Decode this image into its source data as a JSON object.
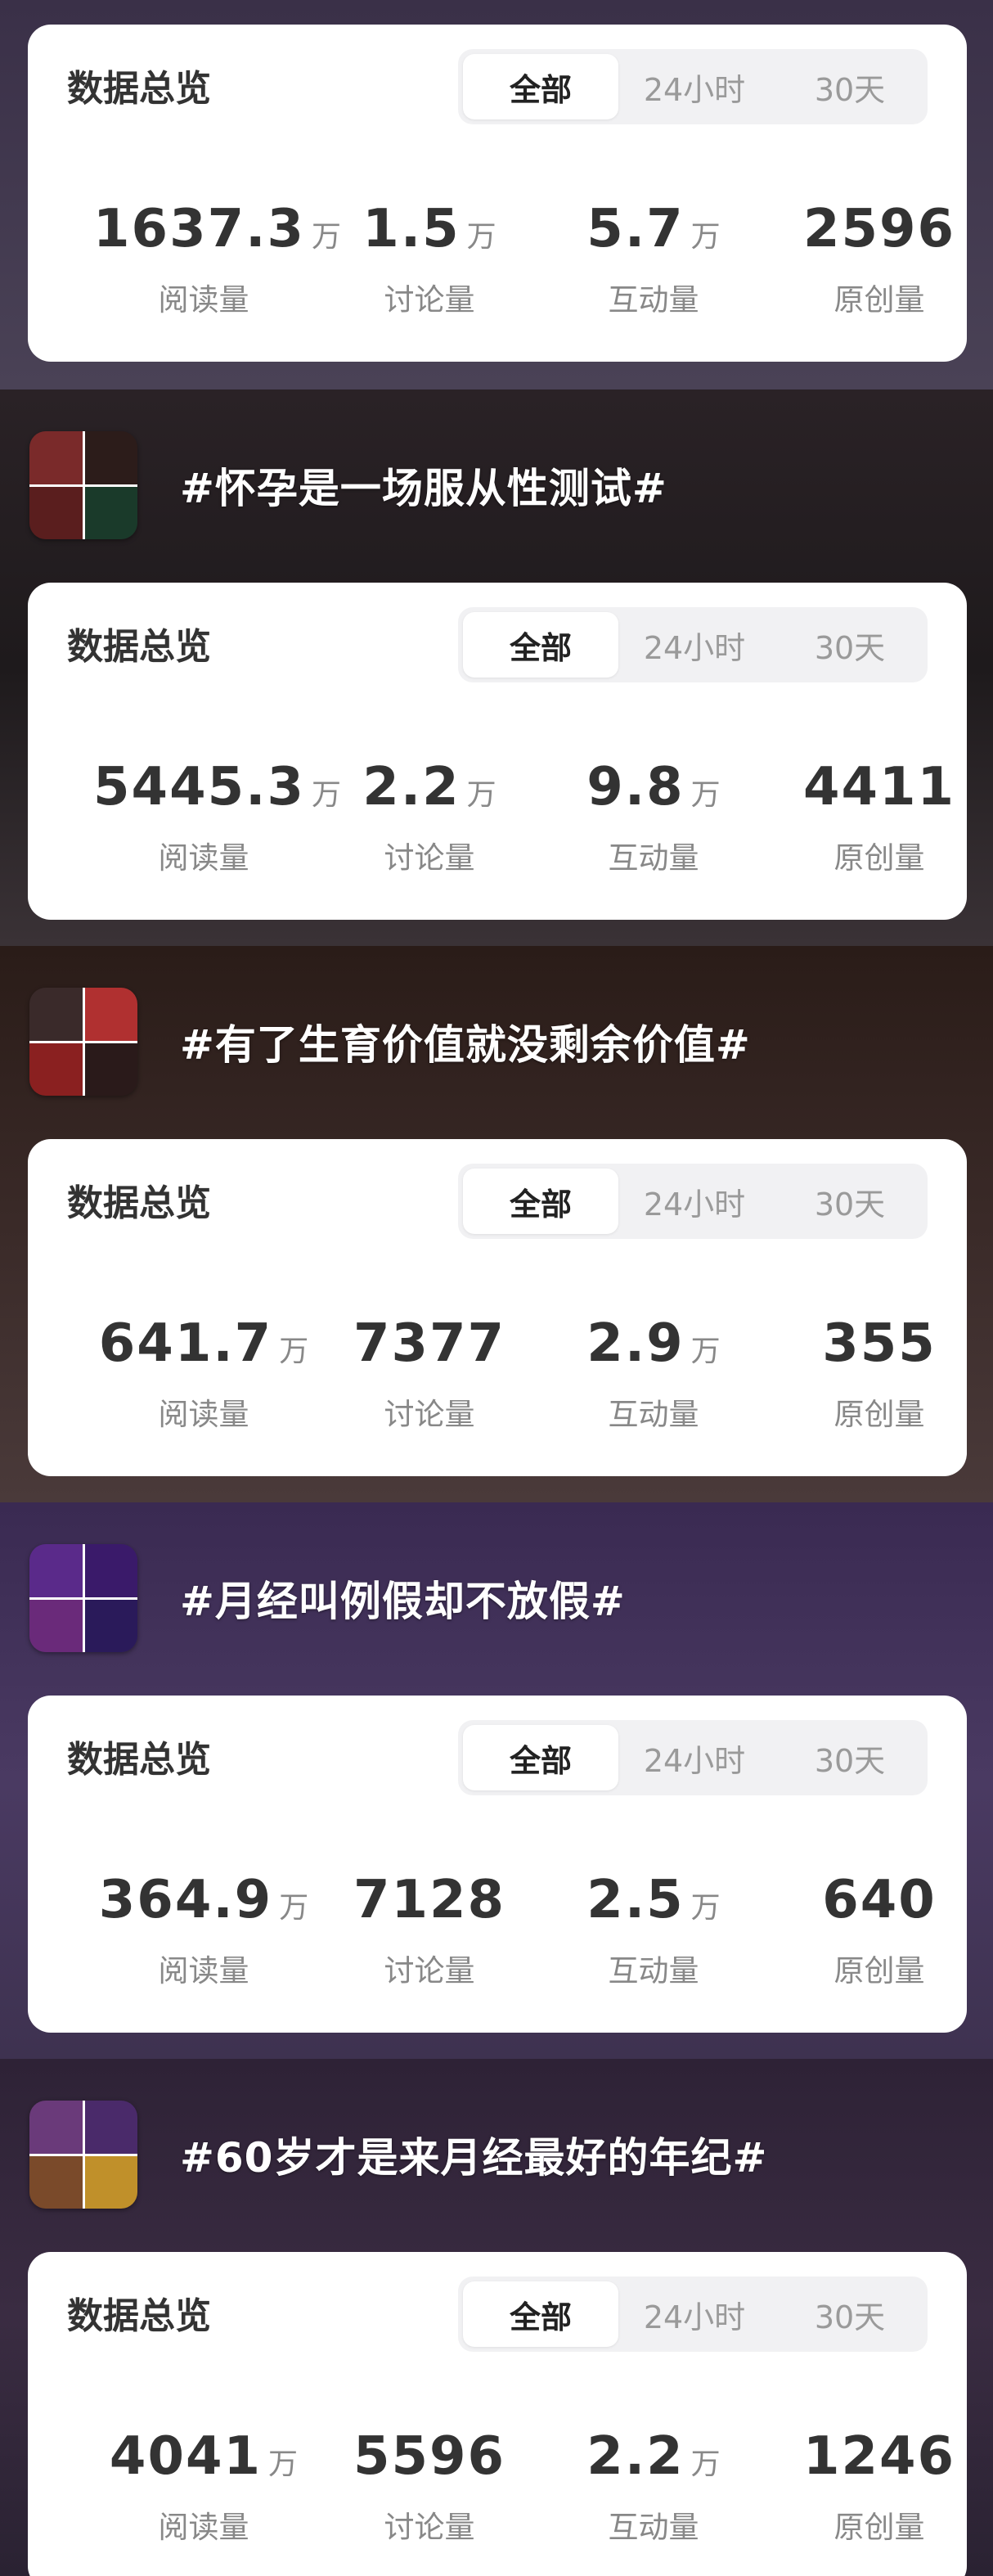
{
  "card_title": "数据总览",
  "tabs": [
    "全部",
    "24小时",
    "30天"
  ],
  "stat_labels": [
    "阅读量",
    "讨论量",
    "互动量",
    "原创量"
  ],
  "unit_wan": "万",
  "sections": [
    {
      "topic": null,
      "stats": [
        {
          "value": "1637.3",
          "unit": "万"
        },
        {
          "value": "1.5",
          "unit": "万"
        },
        {
          "value": "5.7",
          "unit": "万"
        },
        {
          "value": "2596",
          "unit": ""
        }
      ]
    },
    {
      "topic": {
        "title": "#怀孕是一场服从性测试#",
        "thumb_colors": [
          "#7a2a2a",
          "#2c1c1a",
          "#5a1e1e",
          "#1a3a2a"
        ]
      },
      "stats": [
        {
          "value": "5445.3",
          "unit": "万"
        },
        {
          "value": "2.2",
          "unit": "万"
        },
        {
          "value": "9.8",
          "unit": "万"
        },
        {
          "value": "4411",
          "unit": ""
        }
      ]
    },
    {
      "topic": {
        "title": "#有了生育价值就没剩余价值#",
        "thumb_colors": [
          "#3a2a2a",
          "#b03030",
          "#8a2020",
          "#2a1a1a"
        ]
      },
      "stats": [
        {
          "value": "641.7",
          "unit": "万"
        },
        {
          "value": "7377",
          "unit": ""
        },
        {
          "value": "2.9",
          "unit": "万"
        },
        {
          "value": "355",
          "unit": ""
        }
      ]
    },
    {
      "topic": {
        "title": "#月经叫例假却不放假#",
        "thumb_colors": [
          "#5a2a8a",
          "#3a1a6a",
          "#6a2a7a",
          "#2a1a5a"
        ]
      },
      "stats": [
        {
          "value": "364.9",
          "unit": "万"
        },
        {
          "value": "7128",
          "unit": ""
        },
        {
          "value": "2.5",
          "unit": "万"
        },
        {
          "value": "640",
          "unit": ""
        }
      ]
    },
    {
      "topic": {
        "title": "#60岁才是来月经最好的年纪#",
        "thumb_colors": [
          "#6a3a7a",
          "#4a2a6a",
          "#7a4a2a",
          "#c0902a"
        ]
      },
      "stats": [
        {
          "value": "4041",
          "unit": "万"
        },
        {
          "value": "5596",
          "unit": ""
        },
        {
          "value": "2.2",
          "unit": "万"
        },
        {
          "value": "1246",
          "unit": ""
        }
      ]
    }
  ],
  "colors": {
    "section_bgs": [
      "linear-gradient(180deg, #3a3048 0%, #4a4256 100%)",
      "linear-gradient(180deg, #2a2226 0%, #1e1a1c 50%, #3a3236 100%)",
      "linear-gradient(180deg, #2a1c18 0%, #3a2a28 50%, #4a3a3a 100%)",
      "linear-gradient(180deg, #3a2a52 0%, #4a3a62 50%, #3e3250 100%)",
      "linear-gradient(180deg, #2e2236 0%, #3a2c42 50%, #2a2232 100%)"
    ]
  }
}
